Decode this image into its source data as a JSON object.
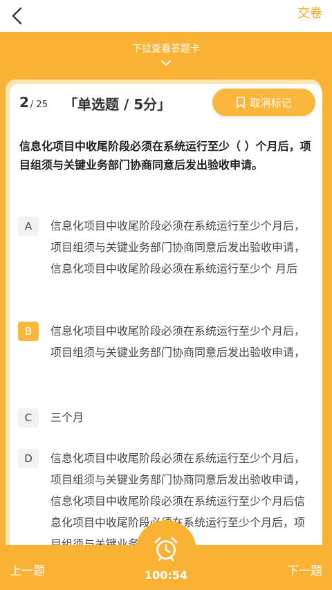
{
  "header": {
    "submit_label": "交卷"
  },
  "pull_hint": "下拉查看答题卡",
  "question": {
    "number": "2",
    "total": "/ 25",
    "type_label": "「单选题 / 5分」",
    "stem": "信息化项目中收尾阶段必须在系统运行至少（   ）个月后，项目组须与关键业务部门协商同意后发出验收申请。"
  },
  "bookmark_label": "取消标记",
  "options": [
    {
      "letter": "A",
      "text": "信息化项目中收尾阶段必须在系统运行至少个月后，项目组须与关键业务部门协商同意后发出验收申请，信息化项目中收尾阶段必须在系统运行至少个 月后",
      "selected": false
    },
    {
      "letter": "B",
      "text": "信息化项目中收尾阶段必须在系统运行至少个月后，项目组须与关键业务部门协商同意后发出验收申请，",
      "selected": true
    },
    {
      "letter": "C",
      "text": "三个月",
      "selected": false
    },
    {
      "letter": "D",
      "text": "信息化项目中收尾阶段必须在系统运行至少个月后，项目组须与关键业务部门协商同意后发出验收申请，信息化项目中收尾阶段必须在系统运行至少个月后信息化项目中收尾阶段必须在系统运行至少个月后，项目组须与关键业务",
      "selected": false
    }
  ],
  "footer": {
    "prev_label": "上一题",
    "next_label": "下一题",
    "timer": "100:54"
  },
  "colors": {
    "accent": "#f9b233",
    "accent_text": "#f5a623"
  }
}
